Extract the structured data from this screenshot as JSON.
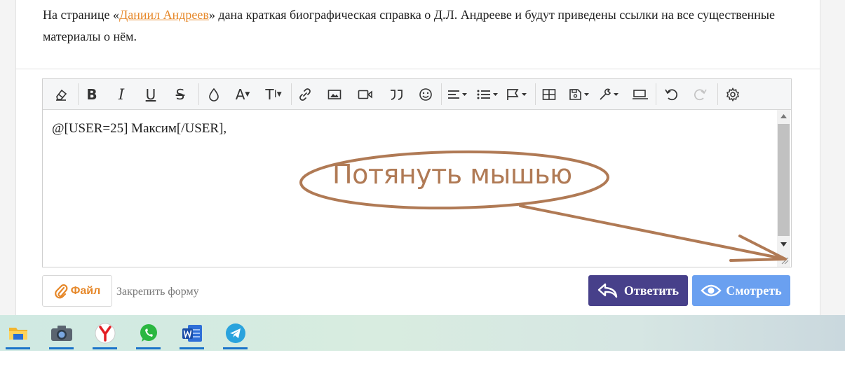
{
  "post": {
    "text_before": "На странице «",
    "link_text": "Даниил Андреев",
    "text_after": "» дана краткая биографическая справка о Д.Л. Андрееве и будут приведены ссылки на все существенные материалы о нём."
  },
  "toolbar": {
    "buttons": [
      "eraser-icon",
      "bold-icon",
      "italic-icon",
      "underline-icon",
      "strikethrough-icon",
      "color-icon",
      "font-family-icon",
      "font-size-icon",
      "link-icon",
      "image-icon",
      "video-icon",
      "quote-icon",
      "smilie-icon",
      "align-icon",
      "list-icon",
      "insert-flag-icon",
      "table-icon",
      "save-draft-icon",
      "tools-icon",
      "preview-toggle-icon",
      "undo-icon",
      "redo-icon",
      "settings-icon"
    ],
    "bold": "B",
    "italic": "I",
    "underline": "U",
    "strike": "S",
    "font_letter": "A",
    "size_letter": "T"
  },
  "editor": {
    "content": "@[USER=25] Максим[/USER],"
  },
  "annotation": {
    "text": "Потянуть мышью",
    "color": "#b07a55"
  },
  "footer": {
    "file_label": "Файл",
    "pin_label": "Закрепить форму",
    "reply_label": "Ответить",
    "preview_label": "Смотреть"
  },
  "taskbar": {
    "apps": [
      "file-explorer-icon",
      "camera-icon",
      "yandex-browser-icon",
      "whatsapp-icon",
      "word-icon",
      "telegram-icon"
    ]
  },
  "colors": {
    "link": "#e6882a",
    "reply_button": "#47408a",
    "preview_button": "#6aa0f0"
  }
}
